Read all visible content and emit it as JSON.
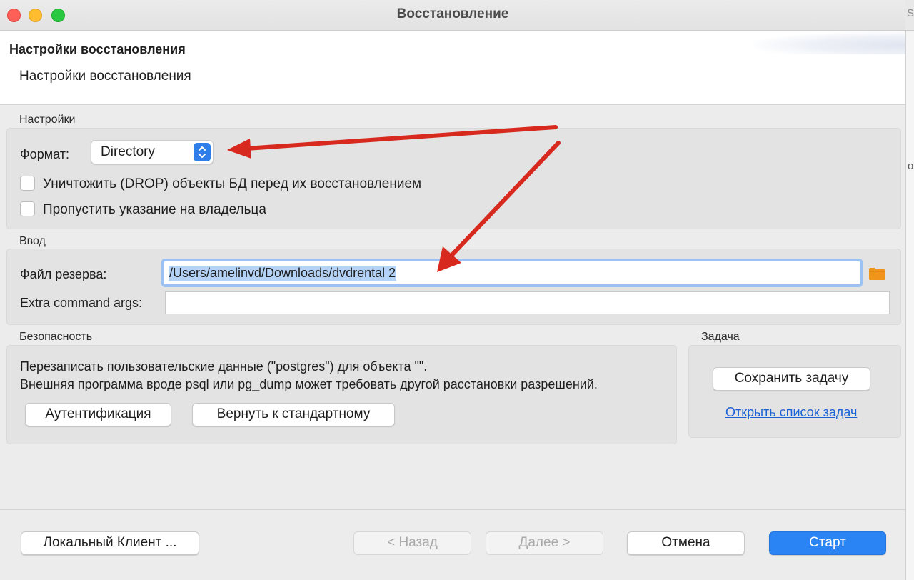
{
  "window": {
    "title": "Восстановление"
  },
  "header": {
    "title": "Настройки восстановления",
    "subtitle": "Настройки восстановления"
  },
  "settings": {
    "section_label": "Настройки",
    "format_label": "Формат:",
    "format_value": "Directory",
    "drop_checkbox_label": "Уничтожить (DROP) объекты БД перед их восстановлением",
    "drop_checked": false,
    "owner_checkbox_label": "Пропустить указание на владельца",
    "owner_checked": false
  },
  "input": {
    "section_label": "Ввод",
    "backup_file_label": "Файл резерва:",
    "backup_file_value": "/Users/amelinvd/Downloads/dvdrental 2",
    "extra_args_label": "Extra command args:",
    "extra_args_value": ""
  },
  "security": {
    "section_label": "Безопасность",
    "line1": "Перезаписать пользовательские данные (\"postgres\") для объекта \"\".",
    "line2": "Внешняя программа вроде psql или pg_dump может требовать другой расстановки разрешений.",
    "auth_button": "Аутентификация",
    "reset_button": "Вернуть к стандартному"
  },
  "task": {
    "section_label": "Задача",
    "save_button": "Сохранить задачу",
    "open_list_link": "Открыть список задач"
  },
  "footer": {
    "local_client_button": "Локальный Клиент ...",
    "back_button": "< Назад",
    "next_button": "Далее >",
    "cancel_button": "Отмена",
    "start_button": "Старт"
  },
  "edge": {
    "glyph_s": "S",
    "glyph_o": "o"
  },
  "colors": {
    "accent": "#2a84f3",
    "annotation_arrow": "#d8291f",
    "folder_icon": "#f0941b"
  }
}
